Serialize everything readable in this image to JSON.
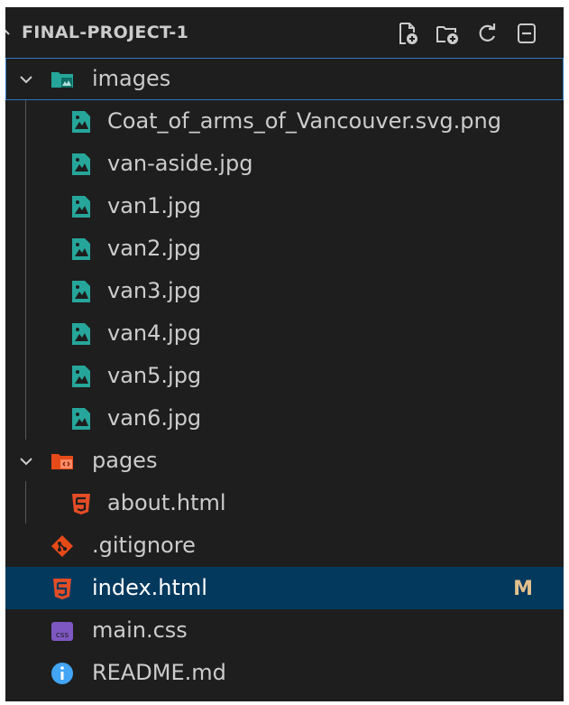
{
  "explorer": {
    "title": "FINAL-PROJECT-1",
    "actions": [
      {
        "name": "new-file-icon"
      },
      {
        "name": "new-folder-icon"
      },
      {
        "name": "refresh-icon"
      },
      {
        "name": "collapse-all-icon"
      }
    ],
    "items": [
      {
        "label": "images",
        "kind": "folder-images",
        "expanded": true,
        "depth": 0
      },
      {
        "label": "Coat_of_arms_of_Vancouver.svg.png",
        "kind": "image-file",
        "depth": 1
      },
      {
        "label": "van-aside.jpg",
        "kind": "image-file",
        "depth": 1
      },
      {
        "label": "van1.jpg",
        "kind": "image-file",
        "depth": 1
      },
      {
        "label": "van2.jpg",
        "kind": "image-file",
        "depth": 1
      },
      {
        "label": "van3.jpg",
        "kind": "image-file",
        "depth": 1
      },
      {
        "label": "van4.jpg",
        "kind": "image-file",
        "depth": 1
      },
      {
        "label": "van5.jpg",
        "kind": "image-file",
        "depth": 1
      },
      {
        "label": "van6.jpg",
        "kind": "image-file",
        "depth": 1
      },
      {
        "label": "pages",
        "kind": "folder-pages",
        "expanded": true,
        "depth": 0
      },
      {
        "label": "about.html",
        "kind": "html-file",
        "depth": 1
      },
      {
        "label": ".gitignore",
        "kind": "git-file",
        "depth": 0
      },
      {
        "label": "index.html",
        "kind": "html-file",
        "depth": 0,
        "badge": "M",
        "selected": true
      },
      {
        "label": "main.css",
        "kind": "css-file",
        "depth": 0
      },
      {
        "label": "README.md",
        "kind": "info-file",
        "depth": 0
      }
    ]
  },
  "colors": {
    "background": "#1e1e1e",
    "selected_row": "#04395e",
    "focus_border": "#2f76bf",
    "image_icon": "#26a69a",
    "html_icon": "#e44d26",
    "git_icon": "#e64a19",
    "css_icon": "#7e57c2",
    "info_icon": "#42a5f5",
    "modified_badge": "#e2c08d"
  }
}
